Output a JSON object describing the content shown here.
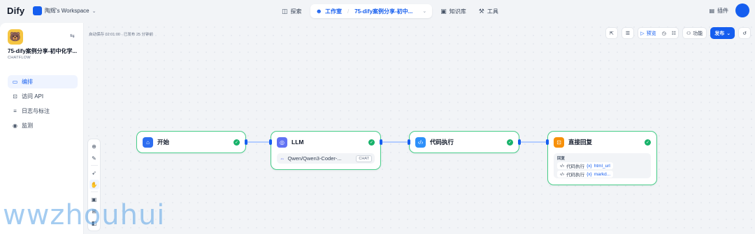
{
  "header": {
    "logo": "Dify",
    "workspace": "陶辉's Workspace",
    "nav": {
      "explore": "探索",
      "studio": "工作室",
      "app_name": "75-dify案例分享-初中...",
      "knowledge": "知识库",
      "tools": "工具"
    },
    "plugins": "插件"
  },
  "sidebar": {
    "app_name": "75-dify案例分享-初中化学...",
    "app_mode": "CHATFLOW",
    "menu": [
      {
        "label": "编排",
        "icon": "layout-icon",
        "active": true
      },
      {
        "label": "访问 API",
        "icon": "terminal-icon",
        "active": false
      },
      {
        "label": "日志与标注",
        "icon": "doc-icon",
        "active": false
      },
      {
        "label": "监测",
        "icon": "monitor-icon",
        "active": false
      }
    ]
  },
  "canvas": {
    "autosave": "自动保存 02:01:00 · 已发布 25 分钟前",
    "toolbar": {
      "preview": "预览",
      "features": "功能",
      "publish": "发布"
    }
  },
  "nodes": {
    "start": {
      "title": "开始",
      "color": "#2e6ef0"
    },
    "llm": {
      "title": "LLM",
      "color": "#6172f3",
      "model": "Qwen/Qwen3-Coder-...",
      "mode_badge": "CHAT"
    },
    "code": {
      "title": "代码执行",
      "color": "#2e90fa"
    },
    "answer": {
      "title": "直接回复",
      "color": "#f79009",
      "section_label": "回复",
      "vars": [
        {
          "node": "代码执行",
          "var": "html_url"
        },
        {
          "node": "代码执行",
          "var": "markd..."
        }
      ]
    }
  },
  "watermark": "wwzhouhui"
}
